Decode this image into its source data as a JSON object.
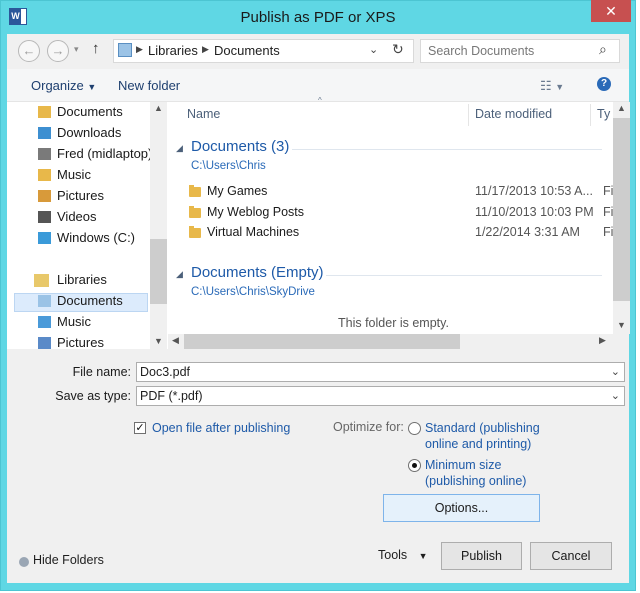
{
  "window": {
    "title": "Publish as PDF or XPS",
    "close_glyph": "✕"
  },
  "address": {
    "crumbs": [
      "Libraries",
      "Documents"
    ],
    "search_placeholder": "Search Documents"
  },
  "toolbar": {
    "organize": "Organize",
    "new_folder": "New folder"
  },
  "nav": {
    "items": [
      "Documents",
      "Downloads",
      "Fred (midlaptop)",
      "Music",
      "Pictures",
      "Videos",
      "Windows (C:)"
    ],
    "libraries_label": "Libraries",
    "library_items": [
      "Documents",
      "Music",
      "Pictures"
    ]
  },
  "columns": {
    "name": "Name",
    "date": "Date modified",
    "type": "Ty"
  },
  "groups": [
    {
      "title": "Documents (3)",
      "path": "C:\\Users\\Chris",
      "files": [
        {
          "name": "My Games",
          "date": "11/17/2013 10:53 A...",
          "type": "Fi"
        },
        {
          "name": "My Weblog Posts",
          "date": "11/10/2013 10:03 PM",
          "type": "Fi"
        },
        {
          "name": "Virtual Machines",
          "date": "1/22/2014 3:31 AM",
          "type": "Fi"
        }
      ]
    },
    {
      "title": "Documents (Empty)",
      "path": "C:\\Users\\Chris\\SkyDrive",
      "empty_text": "This folder is empty."
    }
  ],
  "form": {
    "file_name_label": "File name:",
    "file_name_value": "Doc3.pdf",
    "save_type_label": "Save as type:",
    "save_type_value": "PDF (*.pdf)",
    "open_after_label": "Open file after publishing",
    "optimize_label": "Optimize for:",
    "opt_standard_line1": "Standard (publishing",
    "opt_standard_line2": "online and printing)",
    "opt_min_line1": "Minimum size",
    "opt_min_line2": "(publishing online)",
    "options_button": "Options..."
  },
  "footer": {
    "hide_folders": "Hide Folders",
    "tools": "Tools",
    "publish": "Publish",
    "cancel": "Cancel"
  },
  "colors": {
    "frame": "#5fd7e4",
    "close": "#c75050",
    "link": "#1e5aa8"
  }
}
